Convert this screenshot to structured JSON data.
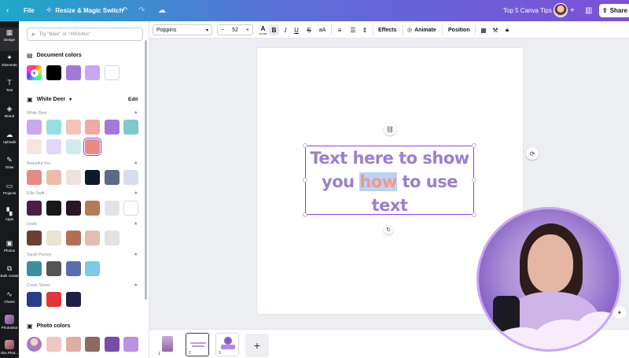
{
  "topbar": {
    "home_icon": "chevron-left-icon",
    "file_label": "File",
    "resize_label": "Resize & Magic Switch",
    "undo_icon": "undo-icon",
    "redo_icon": "redo-icon",
    "cloud_icon": "cloud-sync-icon",
    "doc_title": "Top 5 Canva Tips",
    "add_icon": "plus-icon",
    "analytics_icon": "bar-chart-icon",
    "share_label": "Share",
    "gradient_colors": [
      "#1fa8c9",
      "#5b6fd8",
      "#7d4fd6"
    ]
  },
  "rail": {
    "items": [
      {
        "label": "Design",
        "icon": "design-icon",
        "glyph": "▦"
      },
      {
        "label": "Elements",
        "icon": "elements-icon",
        "glyph": "✦"
      },
      {
        "label": "Text",
        "icon": "text-icon",
        "glyph": "T"
      },
      {
        "label": "Brand",
        "icon": "brand-icon",
        "glyph": "◈"
      },
      {
        "label": "Uploads",
        "icon": "upload-icon",
        "glyph": "☁"
      },
      {
        "label": "Draw",
        "icon": "draw-icon",
        "glyph": "✎"
      },
      {
        "label": "Projects",
        "icon": "folder-icon",
        "glyph": "▭"
      },
      {
        "label": "Apps",
        "icon": "apps-icon",
        "glyph": "▚"
      },
      {
        "label": "Photos",
        "icon": "photos-icon",
        "glyph": "▣"
      },
      {
        "label": "Bulk create",
        "icon": "bulk-create-icon",
        "glyph": "⧉"
      },
      {
        "label": "Charts",
        "icon": "charts-icon",
        "glyph": "∿"
      },
      {
        "label": "Photoshot",
        "icon": "photoshot-thumb",
        "glyph": ""
      },
      {
        "label": "nbo Phot...",
        "icon": "app-thumb",
        "glyph": ""
      }
    ]
  },
  "panel": {
    "search_placeholder": "Try \"blue\" or \"#00c4cc\"",
    "document_colors_title": "Document colors",
    "document_colors": [
      "#000000",
      "#a578dc",
      "#c9a6f2",
      "#ffffff"
    ],
    "kit_title": "White Deer",
    "edit_label": "Edit",
    "palettes": [
      {
        "name": "White Deer",
        "colors": [
          "#c9a6f2",
          "#94dfe3",
          "#f4c4b6",
          "#f2a8a6",
          "#a578dc",
          "#7fc8cc",
          "#f8e4df",
          "#e4d6f7",
          "#cfebf0",
          "#e88b85"
        ]
      },
      {
        "name": "Beautiful You",
        "colors": [
          "#e58a86",
          "#eebbab",
          "#f0e1de",
          "#0e1a2b",
          "#5d6a85",
          "#d7dcef"
        ]
      },
      {
        "name": "Ellie Swift",
        "colors": [
          "#4b1f45",
          "#191919",
          "#2d1424",
          "#b57b55",
          "#e6e1e8",
          "#ffffff"
        ]
      },
      {
        "name": "Linda",
        "colors": [
          "#6b4030",
          "#ece3cf",
          "#b56d52",
          "#e3bdb0",
          "#e6e0e1"
        ]
      },
      {
        "name": "Sarah Purvey",
        "colors": [
          "#3d8ea2",
          "#555555",
          "#5a6cb0",
          "#7cc9e9"
        ]
      },
      {
        "name": "Creek Street",
        "colors": [
          "#2b3b8e",
          "#e0363a",
          "#1f1f4b"
        ]
      }
    ],
    "photo_colors_title": "Photo colors",
    "photo_colors": [
      "#efc9c2",
      "#deafa0",
      "#8c6a62",
      "#7a4ba8",
      "#bb91e1"
    ]
  },
  "toolbar": {
    "font": "Poppins",
    "size_minus": "−",
    "size": "52",
    "size_plus": "+",
    "color_glyph": "A",
    "bold": "B",
    "italic": "I",
    "underline": "U",
    "strike": "S",
    "case": "aA",
    "effects": "Effects",
    "animate": "Animate",
    "position": "Position"
  },
  "canvas": {
    "text_line1": "Text here to show",
    "text_line2_a": "you ",
    "text_line2_highlight": "how",
    "text_line2_b": " to use",
    "text_line3": "text",
    "text_color": "#9b7fce",
    "highlight_color": "#ef9a8a"
  },
  "pages": {
    "thumbs": [
      {
        "num": "1"
      },
      {
        "num": "2"
      },
      {
        "num": "3"
      }
    ],
    "add_label": "+"
  }
}
